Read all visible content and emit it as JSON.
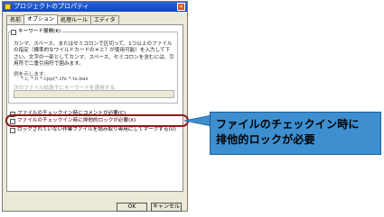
{
  "dialog": {
    "title": "プロジェクトのプロパティ",
    "close_glyph": "×"
  },
  "tabs": [
    {
      "label": "名前"
    },
    {
      "label": "オプション"
    },
    {
      "label": "処理ルール"
    },
    {
      "label": "エディタ"
    }
  ],
  "options": {
    "keyword_expansion_label": "キーワード展開(K)",
    "keyword_desc": "カンマ、スペース、またはセミコロンで区切って、1つ以上のファイルの指定（標準的なワイルドカードの＊と？が使用可能）を入力して下さい。文字の一部としてカンマ、スペース、セミコロンを含むには、引用符で二重引用符で囲みます。",
    "example_label": "例を示します:",
    "example_value": "*.c, *.h *.cpp(*.cfx *.tx.bas",
    "disabled_label": "次のファイル拡張子にキーワードを適用する:",
    "comment_checkbox": "ファイルのチェックイン時にコメントが必要(C)",
    "exclusive_lock_checkbox": "ファイルのチェックイン時に排他的ロックが必要(X)",
    "readonly_checkbox": "ロックされていない作業ファイルを読み取り専用にしてマークする(U)"
  },
  "buttons": {
    "ok": "OK",
    "cancel": "キャンセル"
  },
  "callout": {
    "line1": "ファイルのチェックイン時に",
    "line2": "排他的ロックが必要"
  },
  "colors": {
    "callout_bg": "#3d8fd0",
    "highlight_border": "#8b1a1a"
  }
}
